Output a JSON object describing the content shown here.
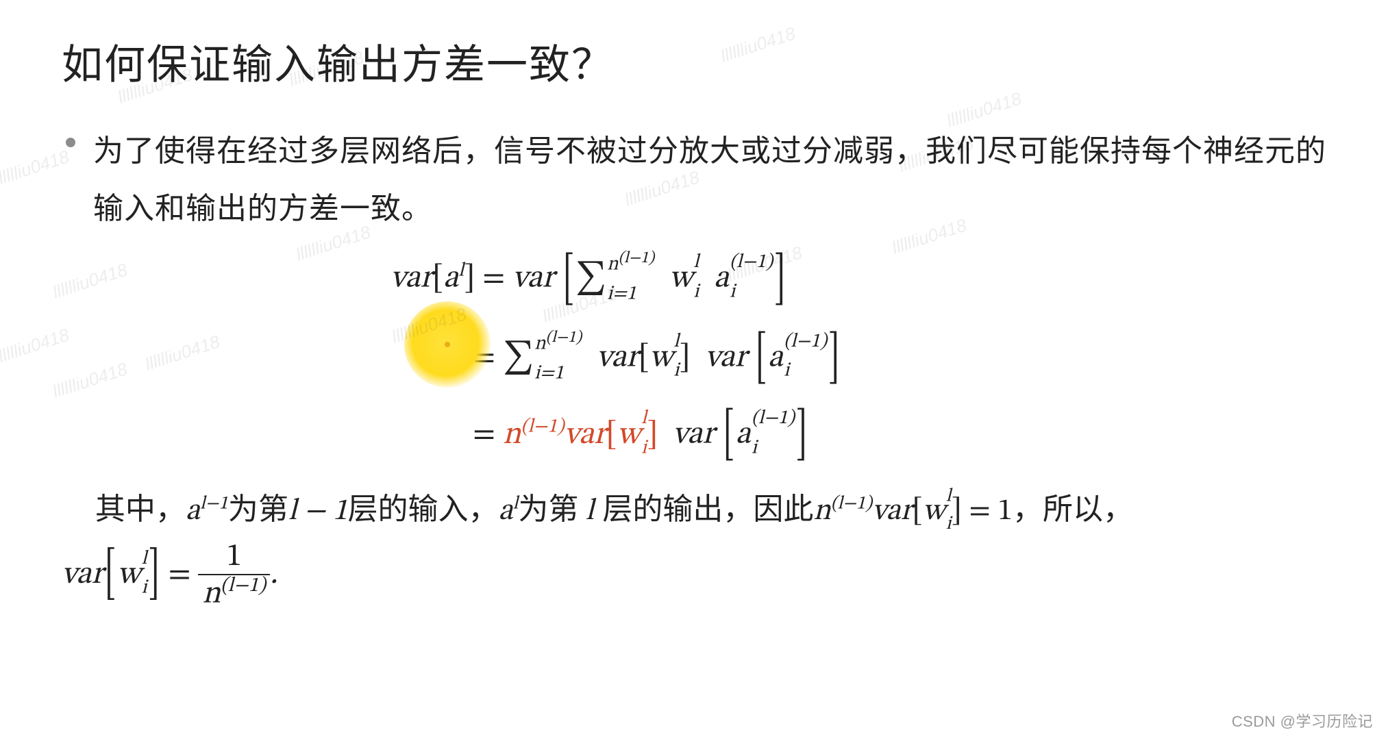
{
  "title": "如何保证输入输出方差一致？",
  "bullet_text": "为了使得在经过多层网络后，信号不被过分放大或过分减弱，我们尽可能保持每个神经元的输入和输出的方差一致。",
  "math": {
    "var_token": "var",
    "a_token": "a",
    "w_token": "w",
    "n_token": "n",
    "l_token": "l",
    "i_token": "i",
    "lm1_token": "l−1",
    "paren_lm1": "(l−1)",
    "eq": " = ",
    "sigma": "∑",
    "sum_lower": "i=1",
    "result_eq_one": " = 1",
    "frac_num": "1"
  },
  "paragraph": {
    "p1": "其中，",
    "p2": "为第",
    "p3": "层的输入，",
    "p4": "为第",
    "p5": " 层的输出，因此",
    "p6": "，所以，",
    "period": "."
  },
  "watermark_text": "lllllliu0418",
  "footer": "CSDN @学习历险记",
  "highlight_color": "#d24a2a"
}
